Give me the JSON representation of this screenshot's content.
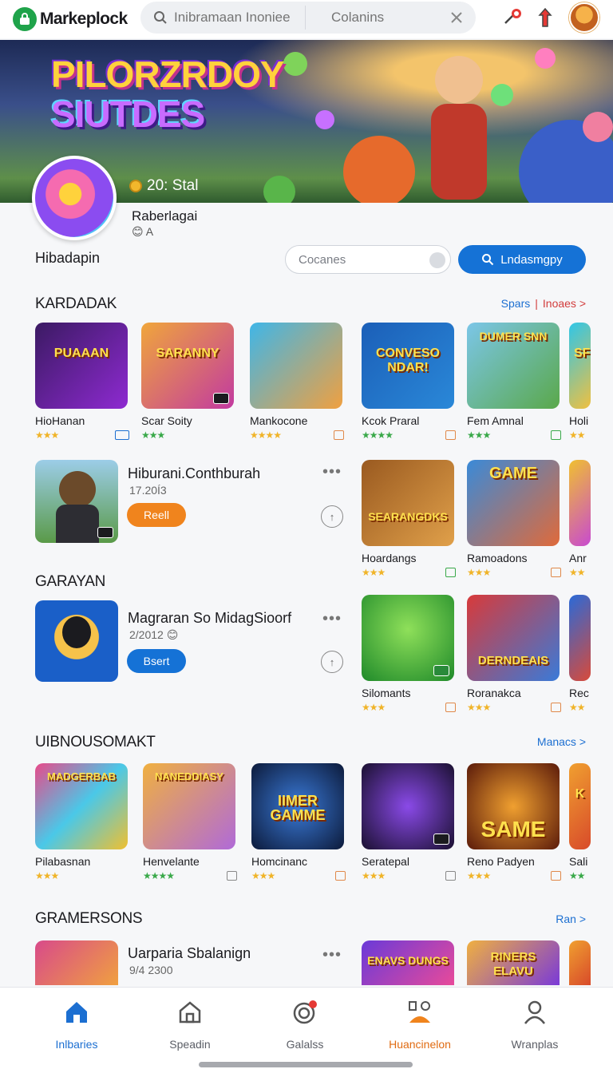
{
  "app": {
    "title": "Markeplock",
    "search_placeholder": "Inibramaan Inoniee",
    "search_filter": "Colanins"
  },
  "banner": {
    "title_line1": "PILORZRDOY",
    "title_line2": "SIUTDES",
    "coins": "20: Stal"
  },
  "profile": {
    "name": "Raberlagai",
    "sub": "😊 A",
    "section": "Hibadapin",
    "category_input": "Cocanes",
    "search_button": "Lndasmgpy"
  },
  "sections": [
    {
      "title": "KARDADAK",
      "link1": "Spars",
      "link2": "Inoaes >"
    },
    {
      "title": "GARAYAN"
    },
    {
      "title": "UIBNOUSOMAKT",
      "link1": "Manacs >"
    },
    {
      "title": "GRAMERSONS",
      "link1": "Ran >"
    }
  ],
  "row1": [
    {
      "name": "HioHanan",
      "thumb_text": "PUAAAN",
      "stars": "★★★"
    },
    {
      "name": "Scar Soity",
      "thumb_text": "SARANNY",
      "stars": "★★★"
    },
    {
      "name": "Mankocone",
      "thumb_text": "",
      "stars": "★★★★"
    },
    {
      "name": "Kcok Praral",
      "thumb_text": "CONVESO NDAR!",
      "stars": "★★★★"
    },
    {
      "name": "Fem Amnal",
      "thumb_text": "DUMER SNN",
      "stars": "★★★"
    },
    {
      "name": "Holi",
      "thumb_text": "SF",
      "stars": "★★"
    }
  ],
  "featured1": {
    "title": "Hiburani.Conthburah",
    "sub": "17.20Í3",
    "button": "Reell"
  },
  "row2": [
    {
      "name": "Hoardangs",
      "thumb_text": "SEARANGDKS",
      "stars": "★★★"
    },
    {
      "name": "Ramoadons",
      "thumb_text": "GAME",
      "stars": "★★★"
    },
    {
      "name": "Anr",
      "thumb_text": "",
      "stars": "★★"
    }
  ],
  "featured2": {
    "title": "Magraran So MidagSioorf",
    "sub": "2/2012 😊",
    "button": "Bsert"
  },
  "row3": [
    {
      "name": "Silomants",
      "thumb_text": "",
      "stars": "★★★"
    },
    {
      "name": "Roranakca",
      "thumb_text": "DERNDEAIS",
      "stars": "★★★"
    },
    {
      "name": "Rec",
      "thumb_text": "",
      "stars": "★★"
    }
  ],
  "row4": [
    {
      "name": "Pilabasnan",
      "thumb_text": "MADGERBAB",
      "stars": "★★★"
    },
    {
      "name": "Henvelante",
      "thumb_text": "NANEDDIASY",
      "stars": "★★★★"
    },
    {
      "name": "Homcinanc",
      "thumb_text": "IIMER GAMME",
      "stars": "★★★"
    },
    {
      "name": "Seratepal",
      "thumb_text": "",
      "stars": "★★★"
    },
    {
      "name": "Reno Padyen",
      "thumb_text": "SAME",
      "stars": "★★★"
    },
    {
      "name": "Sali",
      "thumb_text": "K",
      "stars": "★★"
    }
  ],
  "featured3": {
    "title": "Uarparia Sbalanign",
    "sub": "9/4 2300"
  },
  "row5": [
    {
      "thumb_text": "ENAVS DUNGS"
    },
    {
      "thumb_text": "RINERS ELAVU"
    }
  ],
  "bottom_nav": [
    {
      "label": "Inlbaries",
      "icon": "home-icon"
    },
    {
      "label": "Speadin",
      "icon": "store-icon"
    },
    {
      "label": "Galalss",
      "icon": "target-icon"
    },
    {
      "label": "Huancinelon",
      "icon": "play-icon"
    },
    {
      "label": "Wranplas",
      "icon": "person-icon"
    }
  ],
  "colors": {
    "accent": "#1572d6",
    "orange": "#f0841d",
    "green": "#1fa34a"
  }
}
